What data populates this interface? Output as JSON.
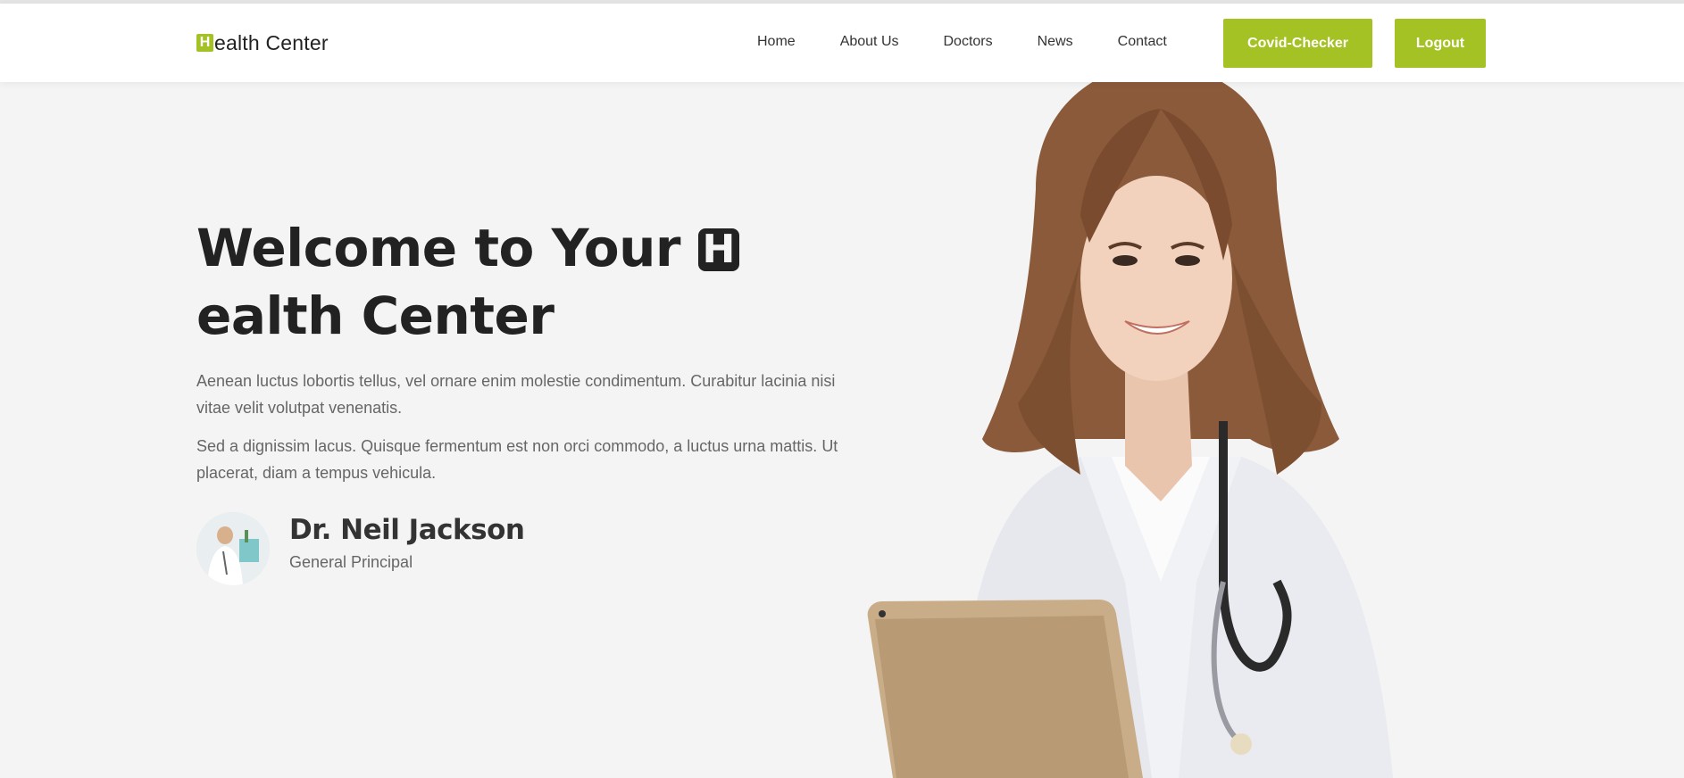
{
  "header": {
    "logo": {
      "badge": "H",
      "text": "ealth Center"
    },
    "nav": [
      "Home",
      "About Us",
      "Doctors",
      "News",
      "Contact"
    ],
    "buttons": {
      "covid": "Covid-Checker",
      "logout": "Logout"
    }
  },
  "hero": {
    "title_before": "Welcome to Your ",
    "title_badge": "H",
    "title_after": "ealth Center",
    "paragraphs": [
      "Aenean luctus lobortis tellus, vel ornare enim molestie condimentum. Curabitur lacinia nisi vitae velit volutpat venenatis.",
      "Sed a dignissim lacus. Quisque fermentum est non orci commodo, a luctus urna mattis. Ut placerat, diam a tempus vehicula."
    ],
    "author": {
      "name": "Dr. Neil Jackson",
      "role": "General Principal"
    }
  },
  "colors": {
    "accent": "#a5c225",
    "hero_bg": "#f4f4f4",
    "text_dark": "#222222"
  }
}
